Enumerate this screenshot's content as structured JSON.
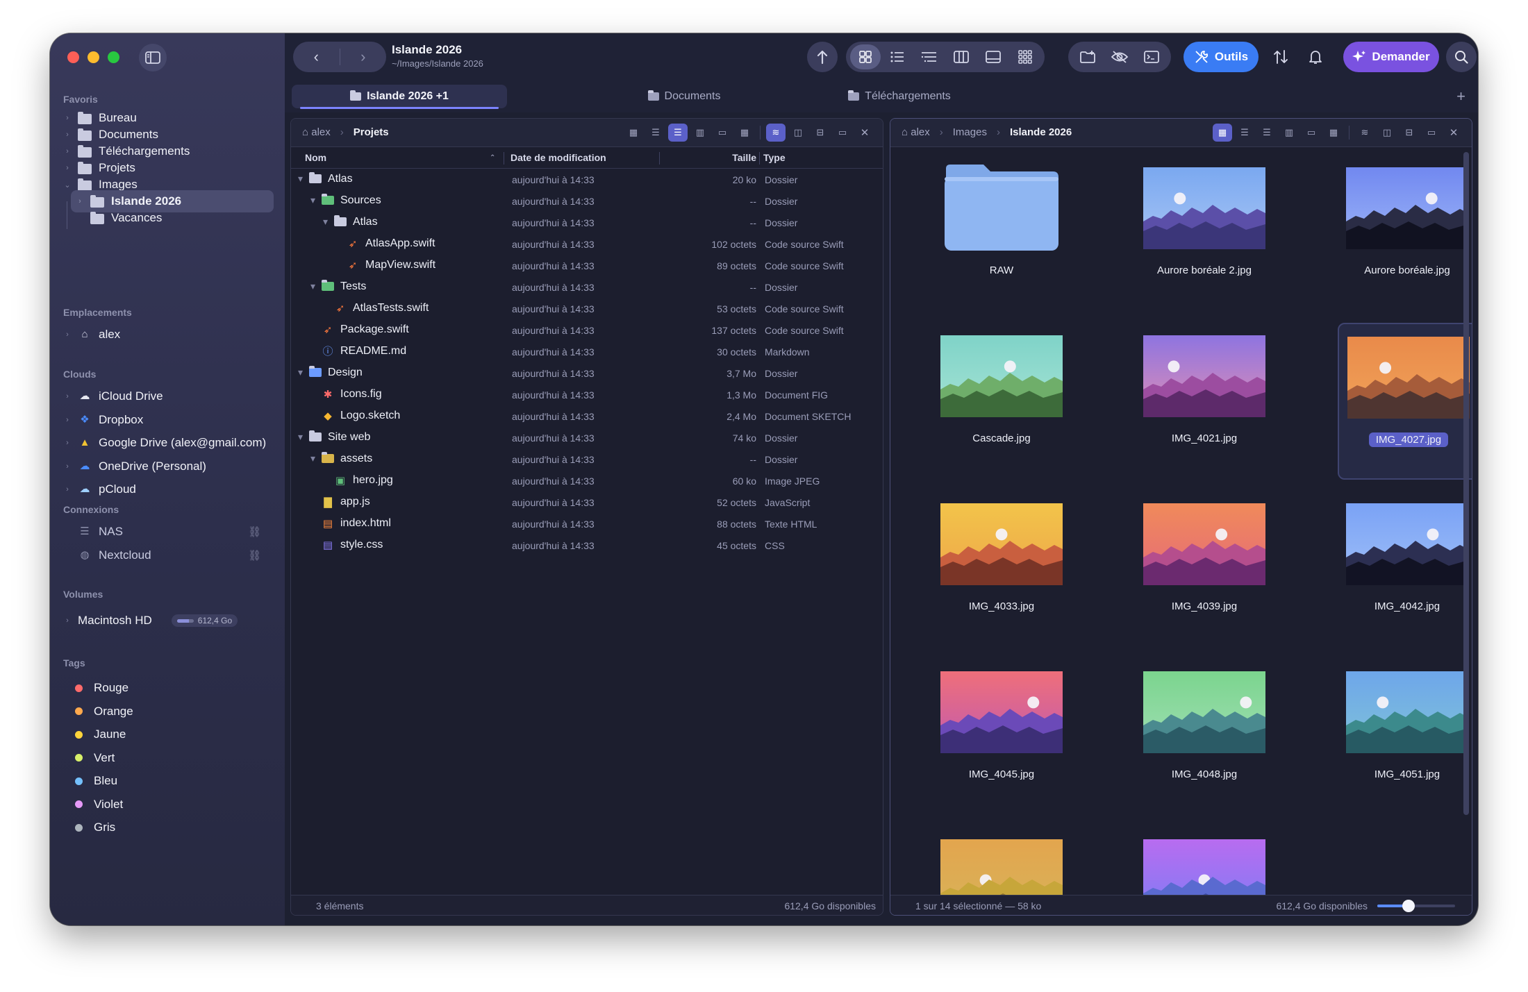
{
  "window": {
    "title": "Islande 2026",
    "path": "~/Images/Islande 2026"
  },
  "toolbar": {
    "outils_label": "Outils",
    "demander_label": "Demander"
  },
  "sidebar": {
    "favoris_title": "Favoris",
    "favoris": [
      {
        "label": "Bureau",
        "icon": "desktop-folder-icon"
      },
      {
        "label": "Documents",
        "icon": "documents-folder-icon"
      },
      {
        "label": "Téléchargements",
        "icon": "downloads-folder-icon"
      },
      {
        "label": "Projets",
        "icon": "folder-icon"
      },
      {
        "label": "Images",
        "icon": "pictures-folder-icon"
      },
      {
        "label": "Islande 2026",
        "icon": "folder-icon"
      },
      {
        "label": "Vacances",
        "icon": "folder-icon"
      }
    ],
    "emplacements_title": "Emplacements",
    "emplacements": [
      {
        "label": "alex",
        "icon": "home-icon"
      }
    ],
    "clouds_title": "Clouds",
    "clouds": [
      {
        "label": "iCloud Drive",
        "icon": "icloud-icon"
      },
      {
        "label": "Dropbox",
        "icon": "dropbox-icon"
      },
      {
        "label": "Google Drive (alex@gmail.com)",
        "icon": "google-drive-icon"
      },
      {
        "label": "OneDrive (Personal)",
        "icon": "onedrive-icon"
      },
      {
        "label": "pCloud",
        "icon": "pcloud-icon"
      }
    ],
    "connexions_title": "Connexions",
    "connexions": [
      {
        "label": "NAS",
        "icon": "nas-icon"
      },
      {
        "label": "Nextcloud",
        "icon": "globe-icon"
      }
    ],
    "volumes_title": "Volumes",
    "volumes": [
      {
        "label": "Macintosh HD",
        "badge": "612,4 Go",
        "used_fraction": 0.7
      }
    ],
    "tags_title": "Tags",
    "tags": [
      {
        "label": "Rouge",
        "color": "#ff6b6b"
      },
      {
        "label": "Orange",
        "color": "#ffa94d"
      },
      {
        "label": "Jaune",
        "color": "#ffd43b"
      },
      {
        "label": "Vert",
        "color": "#d8f06a"
      },
      {
        "label": "Bleu",
        "color": "#74c0fc"
      },
      {
        "label": "Violet",
        "color": "#e599f7"
      },
      {
        "label": "Gris",
        "color": "#adb5bd"
      }
    ]
  },
  "tabs": [
    {
      "label": "Islande 2026  +1",
      "active": true
    },
    {
      "label": "Documents",
      "active": false
    },
    {
      "label": "Téléchargements",
      "active": false
    }
  ],
  "left_pane": {
    "crumbs": [
      "alex",
      "Projets"
    ],
    "columns": {
      "name": "Nom",
      "date": "Date de modification",
      "size": "Taille",
      "type": "Type"
    },
    "rows": [
      {
        "name": "Atlas",
        "date": "aujourd'hui à 14:33",
        "size": "20 ko",
        "type": "Dossier",
        "depth": 0,
        "tw": "open",
        "icon": "folder-open-icon"
      },
      {
        "name": "Sources",
        "date": "aujourd'hui à 14:33",
        "size": "--",
        "type": "Dossier",
        "depth": 1,
        "tw": "open",
        "icon": "folder-green-icon"
      },
      {
        "name": "Atlas",
        "date": "aujourd'hui à 14:33",
        "size": "--",
        "type": "Dossier",
        "depth": 2,
        "tw": "open",
        "icon": "folder-open-icon"
      },
      {
        "name": "AtlasApp.swift",
        "date": "aujourd'hui à 14:33",
        "size": "102 octets",
        "type": "Code source Swift",
        "depth": 3,
        "tw": "",
        "icon": "swift-icon"
      },
      {
        "name": "MapView.swift",
        "date": "aujourd'hui à 14:33",
        "size": "89 octets",
        "type": "Code source Swift",
        "depth": 3,
        "tw": "",
        "icon": "swift-icon"
      },
      {
        "name": "Tests",
        "date": "aujourd'hui à 14:33",
        "size": "--",
        "type": "Dossier",
        "depth": 1,
        "tw": "open",
        "icon": "folder-green-icon"
      },
      {
        "name": "AtlasTests.swift",
        "date": "aujourd'hui à 14:33",
        "size": "53 octets",
        "type": "Code source Swift",
        "depth": 2,
        "tw": "",
        "icon": "swift-icon"
      },
      {
        "name": "Package.swift",
        "date": "aujourd'hui à 14:33",
        "size": "137 octets",
        "type": "Code source Swift",
        "depth": 1,
        "tw": "",
        "icon": "swift-icon"
      },
      {
        "name": "README.md",
        "date": "aujourd'hui à 14:33",
        "size": "30 octets",
        "type": "Markdown",
        "depth": 1,
        "tw": "",
        "icon": "info-icon"
      },
      {
        "name": "Design",
        "date": "aujourd'hui à 14:33",
        "size": "3,7 Mo",
        "type": "Dossier",
        "depth": 0,
        "tw": "open",
        "icon": "folder-blue-icon"
      },
      {
        "name": "Icons.fig",
        "date": "aujourd'hui à 14:33",
        "size": "1,3 Mo",
        "type": "Document FIG",
        "depth": 1,
        "tw": "",
        "icon": "figma-icon"
      },
      {
        "name": "Logo.sketch",
        "date": "aujourd'hui à 14:33",
        "size": "2,4 Mo",
        "type": "Document SKETCH",
        "depth": 1,
        "tw": "",
        "icon": "sketch-icon"
      },
      {
        "name": "Site web",
        "date": "aujourd'hui à 14:33",
        "size": "74 ko",
        "type": "Dossier",
        "depth": 0,
        "tw": "open",
        "icon": "folder-open-icon"
      },
      {
        "name": "assets",
        "date": "aujourd'hui à 14:33",
        "size": "--",
        "type": "Dossier",
        "depth": 1,
        "tw": "open",
        "icon": "folder-yellow-icon"
      },
      {
        "name": "hero.jpg",
        "date": "aujourd'hui à 14:33",
        "size": "60 ko",
        "type": "Image JPEG",
        "depth": 2,
        "tw": "",
        "icon": "image-file-icon"
      },
      {
        "name": "app.js",
        "date": "aujourd'hui à 14:33",
        "size": "52 octets",
        "type": "JavaScript",
        "depth": 1,
        "tw": "",
        "icon": "javascript-icon"
      },
      {
        "name": "index.html",
        "date": "aujourd'hui à 14:33",
        "size": "88 octets",
        "type": "Texte HTML",
        "depth": 1,
        "tw": "",
        "icon": "html-icon"
      },
      {
        "name": "style.css",
        "date": "aujourd'hui à 14:33",
        "size": "45 octets",
        "type": "CSS",
        "depth": 1,
        "tw": "",
        "icon": "css-icon"
      }
    ],
    "status_left": "3 éléments",
    "status_right": "612,4 Go disponibles"
  },
  "right_pane": {
    "crumbs": [
      "alex",
      "Images",
      "Islande 2026"
    ],
    "items": [
      {
        "name": "RAW",
        "kind": "folder"
      },
      {
        "name": "Aurore boréale 2.jpg",
        "kind": "image",
        "sky": [
          "#7aa8f0",
          "#a9c6f5"
        ],
        "hills": [
          "#5b4fa8",
          "#3b3679"
        ],
        "sun": [
          0.3,
          0.38
        ]
      },
      {
        "name": "Aurore boréale.jpg",
        "kind": "image",
        "sky": [
          "#7188f0",
          "#9db6f7"
        ],
        "hills": [
          "#2a2c45",
          "#111221"
        ],
        "sun": [
          0.7,
          0.38
        ]
      },
      {
        "name": "Cascade.jpg",
        "kind": "image",
        "sky": [
          "#7fd3c8",
          "#a6e3d4"
        ],
        "hills": [
          "#6fae6a",
          "#3d6b3a"
        ],
        "sun": [
          0.57,
          0.38
        ]
      },
      {
        "name": "IMG_4021.jpg",
        "kind": "image",
        "sky": [
          "#8e74e0",
          "#e08fb5"
        ],
        "hills": [
          "#9c4da0",
          "#5d2a6a"
        ],
        "sun": [
          0.25,
          0.38
        ]
      },
      {
        "name": "IMG_4027.jpg",
        "kind": "image",
        "sky": [
          "#e98a4a",
          "#f1a45a"
        ],
        "hills": [
          "#a65c3a",
          "#4f3531"
        ],
        "sun": [
          0.31,
          0.38
        ],
        "selected": true
      },
      {
        "name": "IMG_4033.jpg",
        "kind": "image",
        "sky": [
          "#f2c44a",
          "#eea64a"
        ],
        "hills": [
          "#c95f3f",
          "#7a3527"
        ],
        "sun": [
          0.5,
          0.38
        ]
      },
      {
        "name": "IMG_4039.jpg",
        "kind": "image",
        "sky": [
          "#f08a5a",
          "#e56a7a"
        ],
        "hills": [
          "#b54e8d",
          "#6b2a6f"
        ],
        "sun": [
          0.64,
          0.38
        ]
      },
      {
        "name": "IMG_4042.jpg",
        "kind": "image",
        "sky": [
          "#7aa2f5",
          "#a0c0f8"
        ],
        "hills": [
          "#2c2f52",
          "#121324"
        ],
        "sun": [
          0.71,
          0.38
        ]
      },
      {
        "name": "IMG_4045.jpg",
        "kind": "image",
        "sky": [
          "#ef6f7a",
          "#c05ab0"
        ],
        "hills": [
          "#6b4ab8",
          "#3d2f77"
        ],
        "sun": [
          0.76,
          0.38
        ]
      },
      {
        "name": "IMG_4048.jpg",
        "kind": "image",
        "sky": [
          "#7bd48e",
          "#a0dfb4"
        ],
        "hills": [
          "#4a8a8f",
          "#2b5b66"
        ],
        "sun": [
          0.84,
          0.38
        ]
      },
      {
        "name": "IMG_4051.jpg",
        "kind": "image",
        "sky": [
          "#6ea6ea",
          "#7fc3d8"
        ],
        "hills": [
          "#3c8a8c",
          "#275a63"
        ],
        "sun": [
          0.3,
          0.38
        ]
      },
      {
        "name": "",
        "kind": "image",
        "sky": [
          "#e3a54e",
          "#d6b45a"
        ],
        "hills": [
          "#c7a63a",
          "#8b6f2a"
        ],
        "sun": [
          0.37,
          0.5
        ]
      },
      {
        "name": "",
        "kind": "image",
        "sky": [
          "#b86cf0",
          "#7a7ef5"
        ],
        "hills": [
          "#5a6ad0",
          "#3b4aa0"
        ],
        "sun": [
          0.5,
          0.5
        ]
      }
    ],
    "status_left": "1 sur 14 sélectionné — 58 ko",
    "status_right": "612,4 Go disponibles",
    "zoom_fraction": 0.4
  }
}
